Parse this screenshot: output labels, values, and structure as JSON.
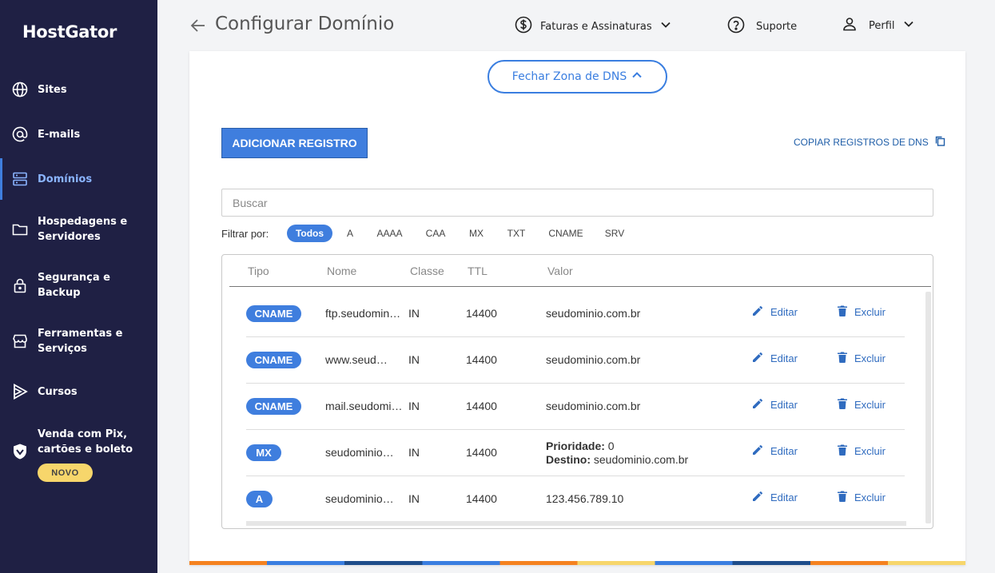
{
  "sidebar": {
    "logo": "HostGator",
    "items": [
      {
        "label": "Sites",
        "icon": "globe-icon"
      },
      {
        "label": "E-mails",
        "icon": "at-icon"
      },
      {
        "label": "Domínios",
        "icon": "server-icon"
      },
      {
        "label": "Hospedagens e Servidores",
        "icon": "folder-icon"
      },
      {
        "label": "Segurança e Backup",
        "icon": "lock-icon"
      },
      {
        "label": "Ferramentas e Serviços",
        "icon": "store-icon"
      },
      {
        "label": "Cursos",
        "icon": "play-icon"
      },
      {
        "label": "Venda com Pix, cartões e boleto",
        "icon": "pix-icon"
      }
    ],
    "new_badge": "NOVO"
  },
  "header": {
    "title": "Configurar Domínio",
    "billing": "Faturas e Assinaturas",
    "support": "Suporte",
    "profile": "Perfil"
  },
  "dns": {
    "close_zone": "Fechar Zona de DNS",
    "add_record": "ADICIONAR REGISTRO",
    "copy_records": "COPIAR REGISTROS DE DNS",
    "search_placeholder": "Buscar",
    "filter_label": "Filtrar por:",
    "filters": [
      "Todos",
      "A",
      "AAAA",
      "CAA",
      "MX",
      "TXT",
      "CNAME",
      "SRV"
    ],
    "columns": {
      "type": "Tipo",
      "name": "Nome",
      "class": "Classe",
      "ttl": "TTL",
      "value": "Valor"
    },
    "edit_label": "Editar",
    "delete_label": "Excluir",
    "records": [
      {
        "type": "CNAME",
        "name": "ftp.seudominio.com.br",
        "class": "IN",
        "ttl": "14400",
        "value": "seudominio.com.br"
      },
      {
        "type": "CNAME",
        "name": "www.seudominio.com.br",
        "class": "IN",
        "ttl": "14400",
        "value": "seudominio.com.br"
      },
      {
        "type": "CNAME",
        "name": "mail.seudominio.com.br",
        "class": "IN",
        "ttl": "14400",
        "value": "seudominio.com.br"
      },
      {
        "type": "MX",
        "name": "seudominio.com.br",
        "class": "IN",
        "ttl": "14400",
        "priority_label": "Prioridade:",
        "priority": "0",
        "dest_label": "Destino:",
        "dest": "seudominio.com.br"
      },
      {
        "type": "A",
        "name": "seudominio.com.br",
        "class": "IN",
        "ttl": "14400",
        "value": "123.456.789.10"
      }
    ]
  },
  "colors": {
    "sidebar_bg": "#1f2044",
    "accent": "#3f7ede",
    "badge": "#f7d66b"
  }
}
